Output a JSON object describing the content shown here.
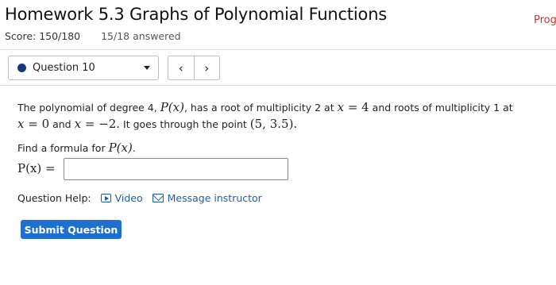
{
  "header": {
    "title": "Homework 5.3 Graphs of Polynomial Functions",
    "progress_link": "Prog",
    "score": "Score: 150/180",
    "answered": "15/18 answered"
  },
  "question_nav": {
    "selected": "Question 10",
    "prev_symbol": "‹",
    "next_symbol": "›"
  },
  "problem": {
    "t1": "The polynomial of degree 4, ",
    "m1": "P(x)",
    "t2": ", has a root of multiplicity 2 at ",
    "m2": "x",
    "m2n": " = 4",
    "t3": " and roots of multiplicity 1 at ",
    "m3": "x",
    "m3n": " = 0",
    "t4": " and ",
    "m4": "x",
    "m4n": " = −2.",
    "t5": " It goes through the point ",
    "m5": "(5, 3.5).",
    "find_text": "Find a formula for ",
    "find_math": "P(x)",
    "find_end": ".",
    "answer_label": "P(x) =",
    "answer_value": ""
  },
  "help": {
    "label": "Question Help:",
    "video": "Video",
    "message": "Message instructor"
  },
  "submit_label": "Submit Question",
  "colors": {
    "accent": "#1f6fd1",
    "link": "#1b5fa8",
    "progress": "#c0392b",
    "dot": "#1a3a7a"
  }
}
